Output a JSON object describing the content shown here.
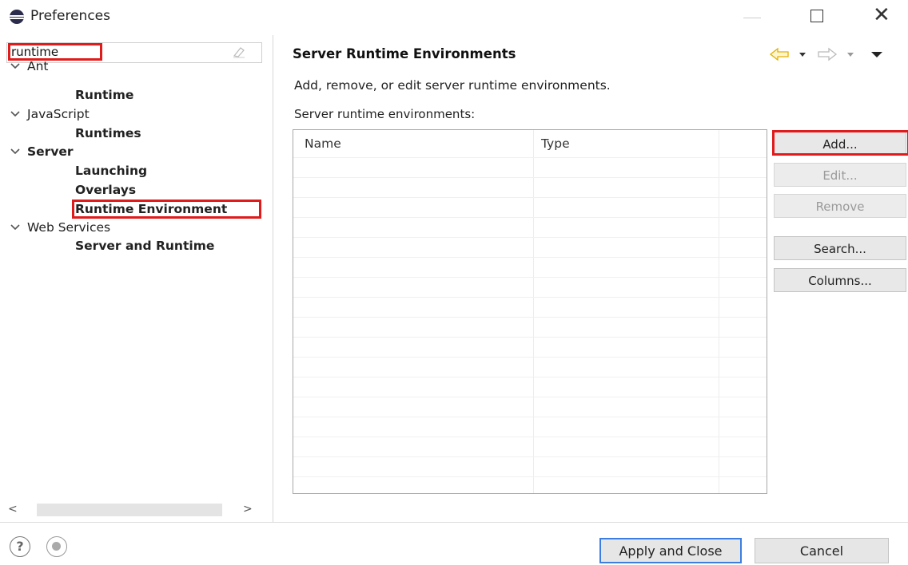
{
  "window": {
    "title": "Preferences"
  },
  "filter": {
    "value": "runtime"
  },
  "tree": [
    {
      "label": "Ant",
      "expanded": true,
      "bold": false
    },
    {
      "label": "Runtime",
      "bold": true
    },
    {
      "label": "JavaScript",
      "expanded": true,
      "bold": false
    },
    {
      "label": "Runtimes",
      "bold": true
    },
    {
      "label": "Server",
      "expanded": true,
      "bold": true
    },
    {
      "label": "Launching",
      "bold": true
    },
    {
      "label": "Overlays",
      "bold": true
    },
    {
      "label": "Runtime Environment",
      "bold": true,
      "selected": true
    },
    {
      "label": "Web Services",
      "expanded": true,
      "bold": false
    },
    {
      "label": "Server and Runtime",
      "bold": true
    }
  ],
  "page": {
    "title": "Server Runtime Environments",
    "description": "Add, remove, or edit server runtime environments.",
    "list_label": "Server runtime environments:",
    "columns": [
      "Name",
      "Type"
    ]
  },
  "buttons": {
    "add": "Add...",
    "edit": "Edit...",
    "remove": "Remove",
    "search": "Search...",
    "columns": "Columns..."
  },
  "footer": {
    "apply_close": "Apply and Close",
    "cancel": "Cancel"
  },
  "colors": {
    "highlight": "#e01b1b",
    "nav_arrow": "#f0c020",
    "primary_border": "#3b7ee0"
  }
}
